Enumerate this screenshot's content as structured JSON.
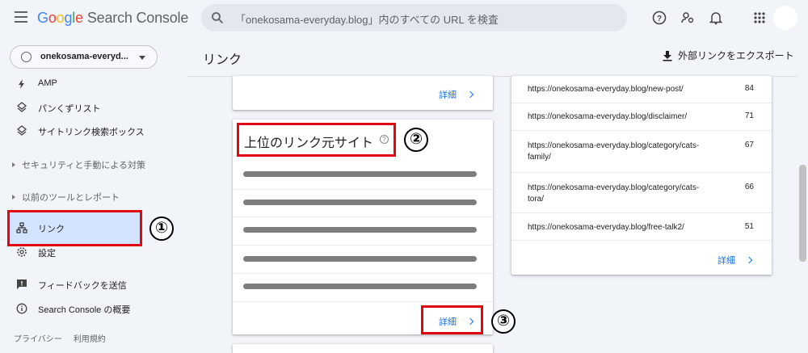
{
  "header": {
    "logo_google": [
      "G",
      "o",
      "o",
      "g",
      "l",
      "e"
    ],
    "logo_product": "Search Console",
    "search_placeholder": "「onekosama-everyday.blog」内のすべての URL を検査"
  },
  "sidebar": {
    "property_name": "onekosama-everyd...",
    "items": [
      {
        "label": "AMP",
        "icon": "bolt-icon"
      },
      {
        "label": "パンくずリスト",
        "icon": "diamond-layers-icon"
      },
      {
        "label": "サイトリンク検索ボックス",
        "icon": "diamond-layers-icon"
      }
    ],
    "section_security": "セキュリティと手動による対策",
    "section_legacy": "以前のツールとレポート",
    "links_label": "リンク",
    "settings_label": "設定",
    "feedback_label": "フィードバックを送信",
    "about_label": "Search Console の概要",
    "footer": [
      "プライバシー",
      "利用規約"
    ]
  },
  "main": {
    "title": "リンク",
    "export_label": "外部リンクをエクスポート",
    "details_label": "詳細",
    "top_sites_title": "上位のリンク元サイト",
    "top_linked_pages": [
      {
        "url": "https://onekosama-everyday.blog/new-post/",
        "count": "84"
      },
      {
        "url": "https://onekosama-everyday.blog/disclaimer/",
        "count": "71"
      },
      {
        "url": "https://onekosama-everyday.blog/category/cats-family/",
        "url_line1": "https://onekosama-everyday.blog/category/cats-",
        "url_line2": "family/",
        "count": "67"
      },
      {
        "url": "https://onekosama-everyday.blog/category/cats-tora/",
        "url_line1": "https://onekosama-everyday.blog/category/cats-",
        "url_line2": "tora/",
        "count": "66"
      },
      {
        "url": "https://onekosama-everyday.blog/free-talk2/",
        "count": "51"
      }
    ]
  },
  "annotations": {
    "num1": "①",
    "num2": "②",
    "num3": "③",
    "highlight_color": "#e00612"
  }
}
